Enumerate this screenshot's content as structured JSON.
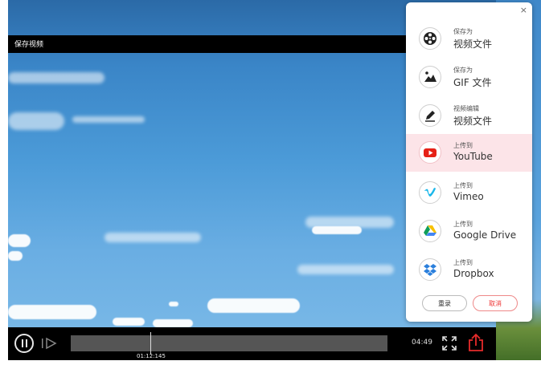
{
  "video": {
    "title": "保存视频",
    "current_time": "01:12:145",
    "total_time": "04:49",
    "progress": 0.25
  },
  "icons": {
    "play": "pause-icon",
    "step": "step-forward-icon",
    "fullscreen": "fullscreen-icon",
    "share": "share-upload-icon"
  },
  "panel": {
    "close": "×",
    "options": [
      {
        "small": "保存为",
        "big": "视频文件",
        "icon": "film-reel-icon",
        "active": false
      },
      {
        "small": "保存为",
        "big": "GIF 文件",
        "icon": "image-gif-icon",
        "active": false
      },
      {
        "small": "视频编辑",
        "big": "视频文件",
        "icon": "edit-pen-icon",
        "active": false
      },
      {
        "small": "上传到",
        "big": "YouTube",
        "icon": "youtube-icon",
        "active": true
      },
      {
        "small": "上传到",
        "big": "Vimeo",
        "icon": "vimeo-icon",
        "active": false
      },
      {
        "small": "上传到",
        "big": "Google Drive",
        "icon": "google-drive-icon",
        "active": false
      },
      {
        "small": "上传到",
        "big": "Dropbox",
        "icon": "dropbox-icon",
        "active": false
      }
    ],
    "reset_label": "重录",
    "cancel_label": "取消"
  },
  "colors": {
    "accent": "#e62b2b",
    "active_row": "#fce4e8",
    "youtube": "#e62117",
    "vimeo": "#1ab7ea"
  }
}
